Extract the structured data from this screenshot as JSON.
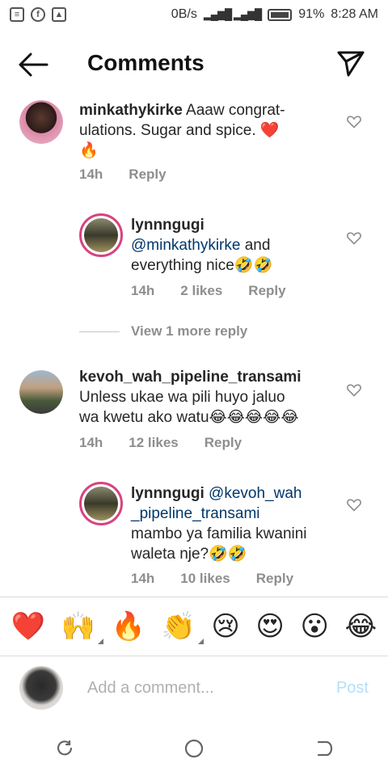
{
  "status": {
    "network": "0B/s",
    "battery": "91%",
    "time": "8:28 AM"
  },
  "header": {
    "title": "Comments"
  },
  "comments": [
    {
      "username": "minkathykirke",
      "text": " Aaaw congrat-",
      "text2": "ulations. Sugar and spice. ❤️",
      "text3": "🔥",
      "time": "14h",
      "likes": "",
      "reply": "Reply"
    },
    {
      "username": "lynnngugi",
      "mention": "@minkathykirke",
      "text": " and",
      "text2": "everything nice🤣🤣",
      "time": "14h",
      "likes": "2 likes",
      "reply": "Reply"
    },
    {
      "username": "kevoh_wah_pipeline_transami",
      "text": "Unless ukae wa pili huyo jaluo",
      "text2": "wa kwetu ako watu😂😂😂😂😂",
      "time": "14h",
      "likes": "12 likes",
      "reply": "Reply"
    },
    {
      "username": "lynnngugi",
      "mention": "@kevoh_wah",
      "mention2": "_pipeline_transami",
      "text": "mambo ya familia kwanini",
      "text2": "waleta nje?🤣🤣",
      "time": "14h",
      "likes": "10 likes",
      "reply": "Reply"
    }
  ],
  "view_more": "View 1 more reply",
  "emoji_bar": [
    "❤️",
    "🙌",
    "🔥",
    "👏",
    "😢",
    "😍",
    "😮",
    "😂"
  ],
  "input": {
    "placeholder": "Add a comment...",
    "post_label": "Post"
  },
  "colors": {
    "link": "#00376b",
    "muted": "#8e8e8e",
    "post_disabled": "#b2dffc",
    "story_ring": "#d9427f"
  }
}
